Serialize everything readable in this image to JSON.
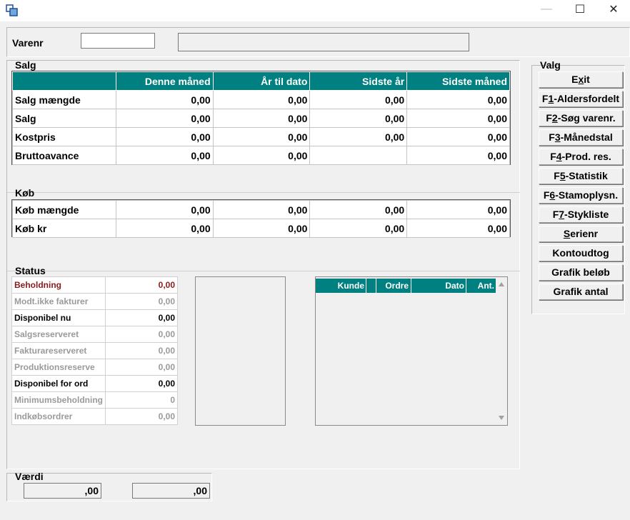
{
  "window": {
    "app_icon": "window-icon",
    "controls": {
      "minimize": "—",
      "maximize": "☐",
      "close": "✕"
    }
  },
  "varenr": {
    "label": "Varenr",
    "value": "",
    "description": ""
  },
  "salg": {
    "title": "Salg",
    "columns": [
      "",
      "Denne måned",
      "År til dato",
      "Sidste år",
      "Sidste måned"
    ],
    "rows": [
      {
        "label": "Salg mængde",
        "values": [
          "0,00",
          "0,00",
          "0,00",
          "0,00"
        ]
      },
      {
        "label": "Salg",
        "values": [
          "0,00",
          "0,00",
          "0,00",
          "0,00"
        ]
      },
      {
        "label": "Kostpris",
        "values": [
          "0,00",
          "0,00",
          "0,00",
          "0,00"
        ]
      },
      {
        "label": "Bruttoavance",
        "values": [
          "0,00",
          "0,00",
          "",
          "0,00"
        ]
      }
    ]
  },
  "kob": {
    "title": "Køb",
    "rows": [
      {
        "label": "Køb mængde",
        "values": [
          "0,00",
          "0,00",
          "0,00",
          "0,00"
        ]
      },
      {
        "label": "Køb kr",
        "values": [
          "0,00",
          "0,00",
          "0,00",
          "0,00"
        ]
      }
    ]
  },
  "status": {
    "title": "Status",
    "rows": [
      {
        "label": "Beholdning",
        "value": "0,00",
        "color": "#8b1a1a"
      },
      {
        "label": "Modt.ikke fakturer",
        "value": "0,00",
        "color": "#9a9a9a"
      },
      {
        "label": "Disponibel nu",
        "value": "0,00",
        "color": "#000000"
      },
      {
        "label": "Salgsreserveret",
        "value": "0,00",
        "color": "#9a9a9a"
      },
      {
        "label": "Fakturareserveret",
        "value": "0,00",
        "color": "#9a9a9a"
      },
      {
        "label": "Produktionsreserve",
        "value": "0,00",
        "color": "#9a9a9a"
      },
      {
        "label": "Disponibel for ord",
        "value": "0,00",
        "color": "#000000"
      },
      {
        "label": "Minimumsbeholdning",
        "value": "0",
        "color": "#9a9a9a"
      },
      {
        "label": "Indkøbsordrer",
        "value": "0,00",
        "color": "#9a9a9a"
      }
    ],
    "order_grid": {
      "columns": [
        "Kunde",
        "Ordre",
        "Dato",
        "Ant."
      ]
    }
  },
  "vaerdi": {
    "title": "Værdi",
    "value1": ",00",
    "value2": ",00"
  },
  "valg": {
    "title": "Valg",
    "buttons": [
      {
        "pre": "E",
        "key": "x",
        "post": "it"
      },
      {
        "pre": "F",
        "key": "1",
        "post": "-Aldersfordelt"
      },
      {
        "pre": "F",
        "key": "2",
        "post": "-Søg varenr."
      },
      {
        "pre": "F",
        "key": "3",
        "post": "-Månedstal"
      },
      {
        "pre": "F",
        "key": "4",
        "post": "-Prod. res."
      },
      {
        "pre": "F",
        "key": "5",
        "post": "-Statistik"
      },
      {
        "pre": "F",
        "key": "6",
        "post": "-Stamoplysn."
      },
      {
        "pre": "F",
        "key": "7",
        "post": "-Stykliste"
      },
      {
        "pre": "",
        "key": "S",
        "post": "erienr"
      },
      {
        "pre": "",
        "key": "",
        "post": "Kontoudtog"
      },
      {
        "pre": "",
        "key": "",
        "post": "Grafik beløb"
      },
      {
        "pre": "",
        "key": "",
        "post": "Grafik antal"
      }
    ]
  }
}
